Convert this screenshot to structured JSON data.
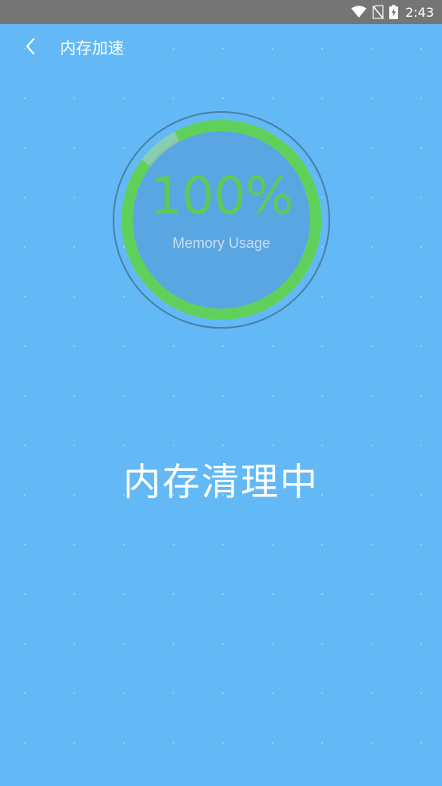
{
  "status_bar": {
    "time": "2:43",
    "icons": [
      "wifi-icon",
      "no-sim-icon",
      "battery-charging-icon"
    ]
  },
  "app_bar": {
    "back_icon": "chevron-left-icon",
    "title": "内存加速"
  },
  "gauge": {
    "value_text": "100%",
    "caption": "Memory Usage",
    "progress_percent": 93,
    "colors": {
      "arc": "#5fd15a",
      "arc_track": "#a9e07a",
      "inner_disc": "#5aa6e3",
      "outer_ring": "#4a7fa6",
      "value_text": "#5ccb5a"
    }
  },
  "status_message": "内存清理中",
  "theme": {
    "background": "#63b8f6",
    "status_bar": "#757575"
  }
}
